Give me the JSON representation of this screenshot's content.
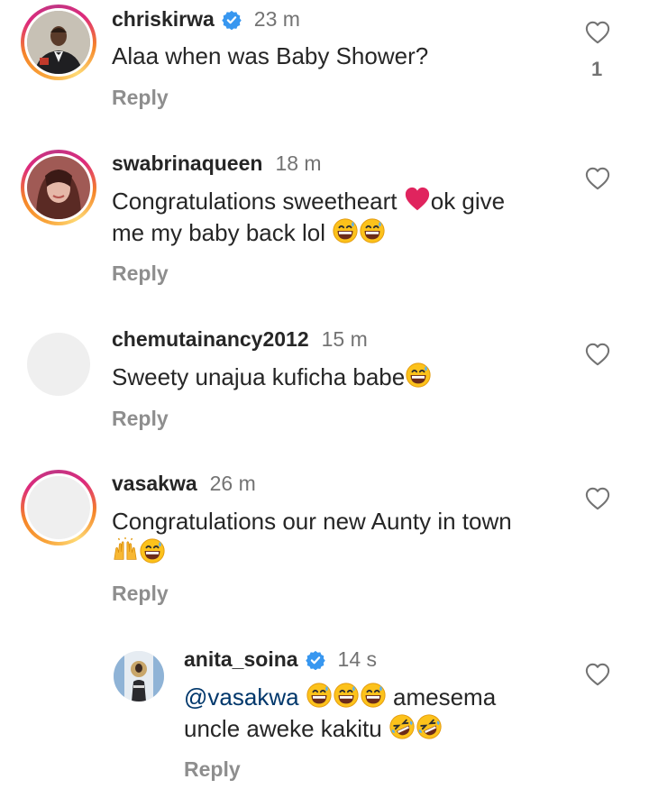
{
  "reply_label": "Reply",
  "comments": [
    {
      "username": "chriskirwa",
      "verified": true,
      "time": "23 m",
      "text": "Alaa when was Baby Shower?",
      "likes": "1",
      "avatar": "man-in-tuxedo-photo",
      "story_ring": true
    },
    {
      "username": "swabrinaqueen",
      "verified": false,
      "time": "18 m",
      "text_line1_a": "Congratulations sweetheart ",
      "text_line1_b": "ok give",
      "text_line2": "me my baby back lol ",
      "avatar": "woman-selfie-photo",
      "story_ring": true
    },
    {
      "username": "chemutainancy2012",
      "verified": false,
      "time": "15 m",
      "text": "Sweety unajua kuficha babe",
      "avatar": "empty-avatar",
      "story_ring": false
    },
    {
      "username": "vasakwa",
      "verified": false,
      "time": "26 m",
      "text_line1": "Congratulations our new Aunty in town",
      "avatar": "empty-avatar",
      "story_ring": true
    },
    {
      "username": "anita_soina",
      "verified": true,
      "time": "14 s",
      "mention": "@vasakwa",
      "text_line1_b": " amesema",
      "text_line2": "uncle aweke kakitu ",
      "avatar": "person-at-podium-photo",
      "story_ring": false
    }
  ],
  "colors": {
    "text": "#262626",
    "secondary": "#737373",
    "reply": "#8e8e8e",
    "verified": "#3897f0",
    "heart_red": "#e0245e"
  }
}
